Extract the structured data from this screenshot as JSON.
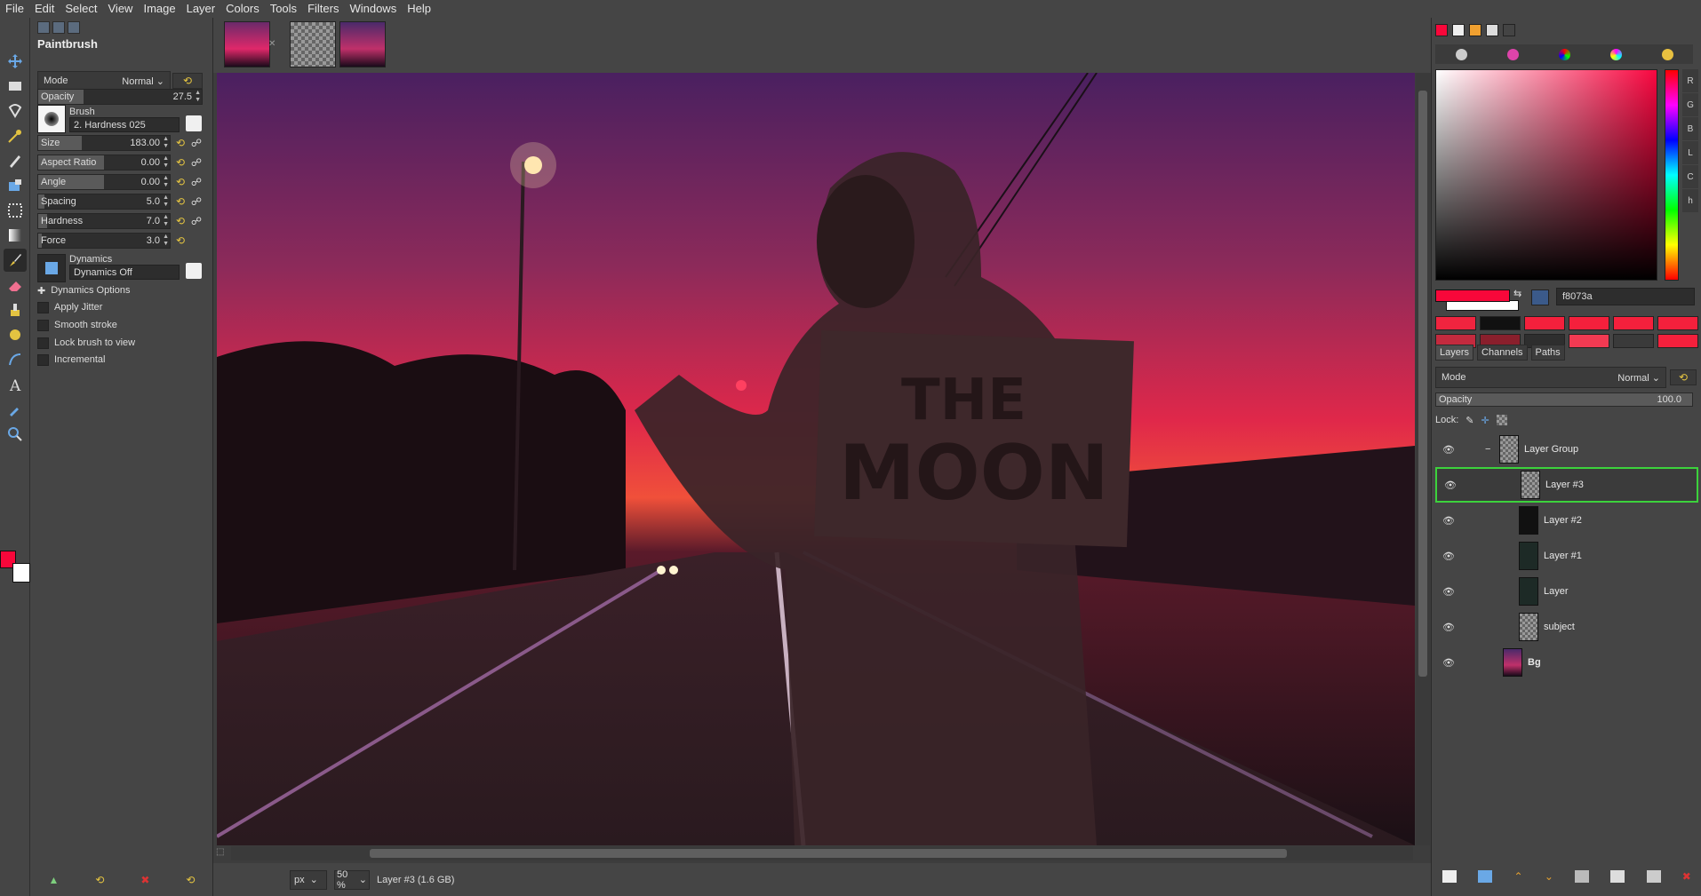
{
  "menubar": {
    "items": [
      "File",
      "Edit",
      "Select",
      "View",
      "Image",
      "Layer",
      "Colors",
      "Tools",
      "Filters",
      "Windows",
      "Help"
    ]
  },
  "tool_options": {
    "title": "Paintbrush",
    "mode_label": "Mode",
    "mode_value": "Normal",
    "opacity": {
      "label": "Opacity",
      "value": "27.5",
      "fraction": 0.275
    },
    "brush": {
      "label": "Brush",
      "name": "2. Hardness 025"
    },
    "size": {
      "label": "Size",
      "value": "183.00",
      "fraction": 0.33
    },
    "aspect_ratio": {
      "label": "Aspect Ratio",
      "value": "0.00",
      "fraction": 0.5
    },
    "angle": {
      "label": "Angle",
      "value": "0.00",
      "fraction": 0.5
    },
    "spacing": {
      "label": "Spacing",
      "value": "5.0",
      "fraction": 0.05
    },
    "hardness": {
      "label": "Hardness",
      "value": "7.0",
      "fraction": 0.07
    },
    "force": {
      "label": "Force",
      "value": "3.0",
      "fraction": 0.03
    },
    "dynamics": {
      "label": "Dynamics",
      "value": "Dynamics Off"
    },
    "dynamics_options": "Dynamics Options",
    "checkboxes": [
      "Apply Jitter",
      "Smooth stroke",
      "Lock brush to view",
      "Incremental"
    ]
  },
  "status": {
    "unit": "px",
    "zoom": "50 %",
    "message": "Layer #3 (1.6 GB)"
  },
  "colors": {
    "foreground": "#f8073a",
    "background": "#ffffff",
    "hex": "f8073a",
    "channel_letters": [
      "R",
      "G",
      "B",
      "L",
      "C",
      "h"
    ],
    "palette": [
      "#f0243f",
      "#111111",
      "#f5203c",
      "#f5203c",
      "#f5203c",
      "#f5203c",
      "#c42a3e",
      "#8a1f2c",
      "#2e2e2e",
      "#f23a52",
      "#3a3a3a",
      "#f5203c"
    ]
  },
  "layers_panel": {
    "tabs": [
      "Layers",
      "Channels",
      "Paths"
    ],
    "mode_label": "Mode",
    "mode_value": "Normal",
    "opacity_label": "Opacity",
    "opacity_value": "100.0",
    "lock_label": "Lock:",
    "layers": [
      {
        "name": "Layer Group",
        "selected": false
      },
      {
        "name": "Layer #3",
        "selected": true
      },
      {
        "name": "Layer #2",
        "selected": false
      },
      {
        "name": "Layer #1",
        "selected": false
      },
      {
        "name": "Layer",
        "selected": false
      },
      {
        "name": "subject",
        "selected": false
      },
      {
        "name": "Bg",
        "selected": false
      }
    ]
  },
  "image": {
    "sign_text": "THE MOON"
  }
}
